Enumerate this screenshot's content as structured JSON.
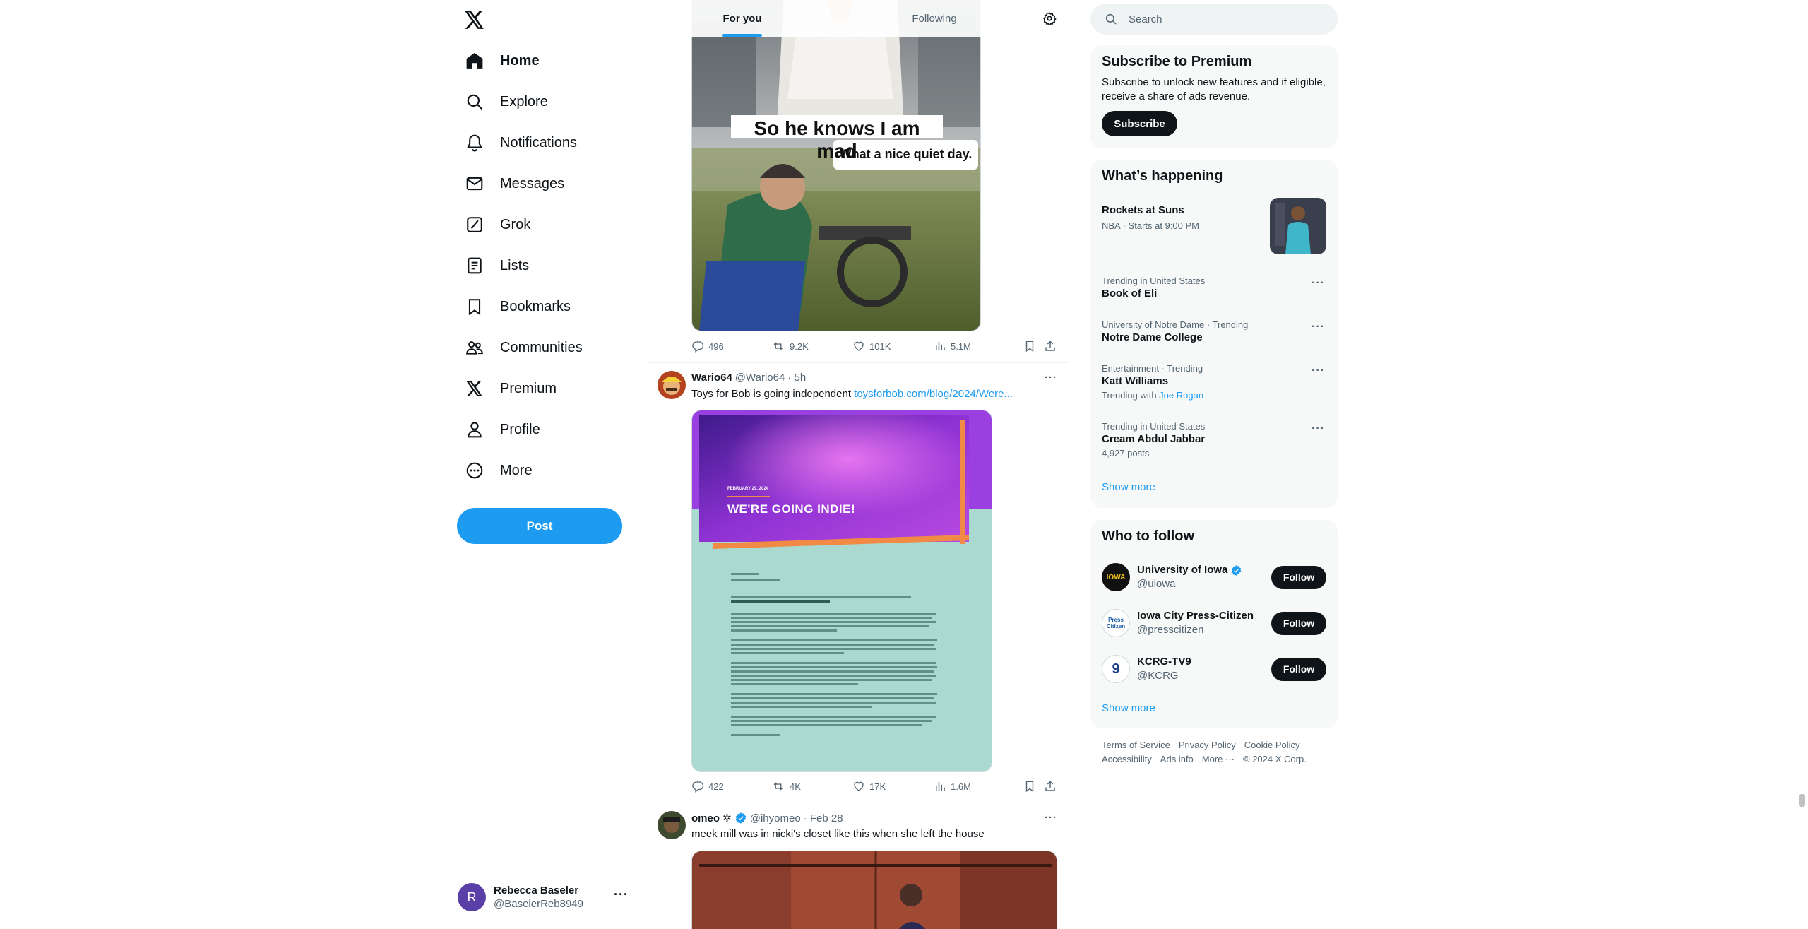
{
  "nav": {
    "items": [
      {
        "label": "Home",
        "icon": "home-icon"
      },
      {
        "label": "Explore",
        "icon": "search-icon"
      },
      {
        "label": "Notifications",
        "icon": "bell-icon"
      },
      {
        "label": "Messages",
        "icon": "envelope-icon"
      },
      {
        "label": "Grok",
        "icon": "grok-icon"
      },
      {
        "label": "Lists",
        "icon": "list-icon"
      },
      {
        "label": "Bookmarks",
        "icon": "bookmark-icon"
      },
      {
        "label": "Communities",
        "icon": "people-icon"
      },
      {
        "label": "Premium",
        "icon": "x-logo-icon"
      },
      {
        "label": "Profile",
        "icon": "person-icon"
      },
      {
        "label": "More",
        "icon": "more-circle-icon"
      }
    ],
    "post_label": "Post",
    "account": {
      "initial": "R",
      "name": "Rebecca Baseler",
      "handle": "@BaselerReb8949",
      "avatar_color": "#5a3fa8"
    }
  },
  "timeline": {
    "tabs": [
      "For you",
      "Following"
    ],
    "tweet1": {
      "meme_top_text": "So he knows I am mad",
      "meme_bottom_text": "What a nice quiet day.",
      "replies": "496",
      "reposts": "9.2K",
      "likes": "101K",
      "views": "5.1M"
    },
    "tweet2": {
      "name": "Wario64",
      "handle": "@Wario64",
      "time": "· 5h",
      "text": "Toys for Bob is going independent ",
      "link": "toysforbob.com/blog/2024/Were...",
      "image_headline": "WE'RE GOING INDIE!",
      "image_date": "FEBRUARY 29, 2024",
      "replies": "422",
      "reposts": "4K",
      "likes": "17K",
      "views": "1.6M"
    },
    "tweet3": {
      "name": "omeo ✲",
      "handle": "@ihyomeo",
      "time": "· Feb 28",
      "text": "meek mill was in nicki's closet like this when she left the house"
    }
  },
  "sidebar": {
    "search_placeholder": "Search",
    "premium": {
      "title": "Subscribe to Premium",
      "text": "Subscribe to unlock new features and if eligible, receive a share of ads revenue.",
      "button": "Subscribe"
    },
    "happening": {
      "title": "What’s happening",
      "event": {
        "name": "Rockets at Suns",
        "meta": "NBA · Starts at 9:00 PM"
      },
      "trends": [
        {
          "context": "Trending in United States",
          "name": "Book of Eli",
          "meta": ""
        },
        {
          "context": "University of Notre Dame · Trending",
          "name": "Notre Dame College",
          "meta": ""
        },
        {
          "context": "Entertainment · Trending",
          "name": "Katt Williams",
          "meta_prefix": "Trending with ",
          "meta_link": "Joe Rogan"
        },
        {
          "context": "Trending in United States",
          "name": "Cream Abdul Jabbar",
          "meta": "4,927 posts"
        }
      ],
      "show_more": "Show more"
    },
    "follow": {
      "title": "Who to follow",
      "accounts": [
        {
          "name": "University of Iowa",
          "handle": "@uiowa",
          "avatar_text": "IOWA",
          "verified": true
        },
        {
          "name": "Iowa City Press-Citizen",
          "handle": "@presscitizen",
          "avatar_text": "Press Citizen",
          "verified": false
        },
        {
          "name": "KCRG-TV9",
          "handle": "@KCRG",
          "avatar_text": "9",
          "verified": false
        }
      ],
      "button": "Follow",
      "show_more": "Show more"
    },
    "footer": {
      "links": [
        "Terms of Service",
        "Privacy Policy",
        "Cookie Policy",
        "Accessibility",
        "Ads info",
        "More ···"
      ],
      "copyright": "© 2024 X Corp."
    }
  },
  "colors": {
    "accent": "#1d9bf0",
    "text": "#0f1419",
    "muted": "#536471"
  }
}
